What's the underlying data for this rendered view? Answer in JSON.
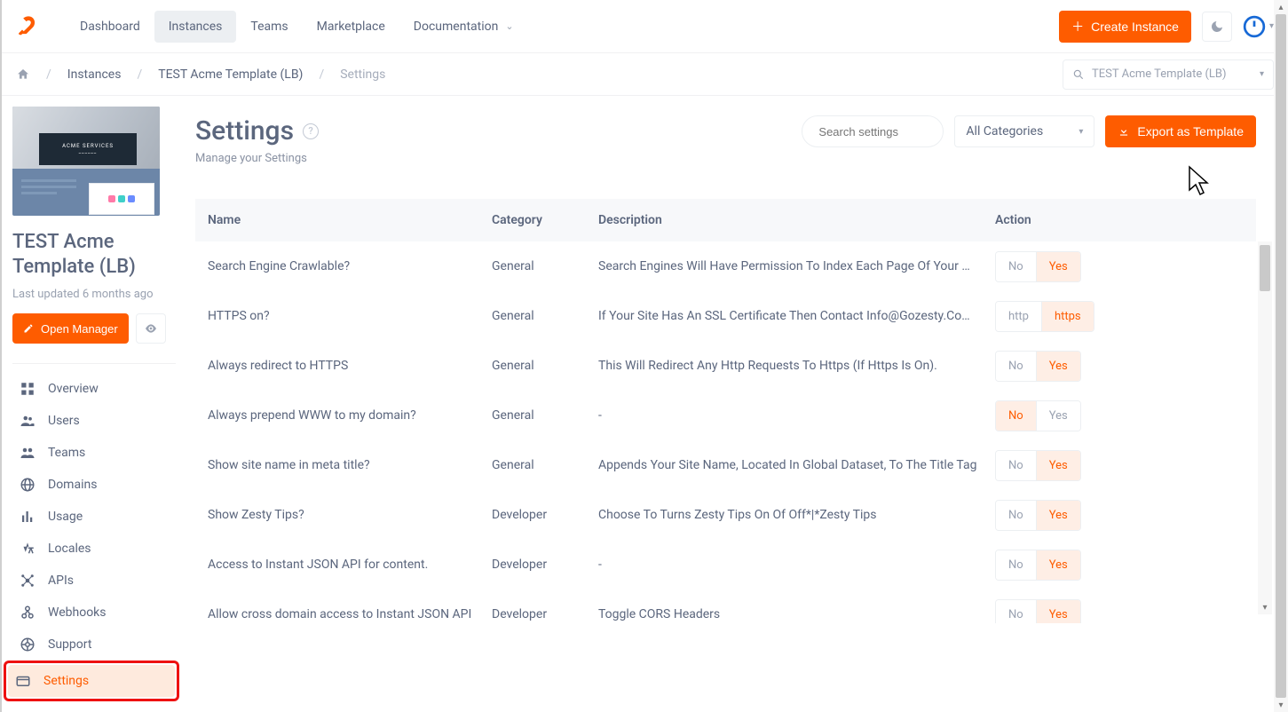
{
  "nav": {
    "items": [
      "Dashboard",
      "Instances",
      "Teams",
      "Marketplace"
    ],
    "active_index": 1,
    "documentation": "Documentation",
    "create_button": "Create Instance"
  },
  "breadcrumb": {
    "items": [
      "Instances",
      "TEST Acme Template (LB)",
      "Settings"
    ],
    "search_value": "TEST Acme Template (LB)"
  },
  "sidebar": {
    "instance_name": "TEST Acme Template (LB)",
    "updated": "Last updated 6 months ago",
    "open_manager": "Open Manager",
    "thumb_title": "ACME SERVICES",
    "items": [
      {
        "icon": "dashboard",
        "label": "Overview"
      },
      {
        "icon": "users",
        "label": "Users"
      },
      {
        "icon": "teams",
        "label": "Teams"
      },
      {
        "icon": "globe",
        "label": "Domains"
      },
      {
        "icon": "bars",
        "label": "Usage"
      },
      {
        "icon": "locale",
        "label": "Locales"
      },
      {
        "icon": "api",
        "label": "APIs"
      },
      {
        "icon": "webhook",
        "label": "Webhooks"
      },
      {
        "icon": "support",
        "label": "Support"
      },
      {
        "icon": "settings",
        "label": "Settings"
      }
    ],
    "active_index": 9
  },
  "page": {
    "title": "Settings",
    "subtitle": "Manage your Settings",
    "search_placeholder": "Search settings",
    "category_select": "All Categories",
    "export_button": "Export as Template"
  },
  "table": {
    "headers": {
      "name": "Name",
      "category": "Category",
      "description": "Description",
      "action": "Action"
    },
    "rows": [
      {
        "name": "Search Engine Crawlable?",
        "category": "General",
        "description": "Search Engines Will Have Permission To Index Each Page Of Your Site Allowing F...",
        "options": [
          "No",
          "Yes"
        ],
        "selected": 1
      },
      {
        "name": "HTTPS on?",
        "category": "General",
        "description": "If Your Site Has An SSL Certificate Then Contact Info@Gozesty.Com About Secur...",
        "options": [
          "http",
          "https"
        ],
        "selected": 1
      },
      {
        "name": "Always redirect to HTTPS",
        "category": "General",
        "description": "This Will Redirect Any Http Requests To Https (If Https Is On).",
        "options": [
          "No",
          "Yes"
        ],
        "selected": 1
      },
      {
        "name": "Always prepend WWW to my domain?",
        "category": "General",
        "description": "-",
        "options": [
          "No",
          "Yes"
        ],
        "selected": 0
      },
      {
        "name": "Show site name in meta title?",
        "category": "General",
        "description": "Appends Your Site Name, Located In Global Dataset, To The Title Tag",
        "options": [
          "No",
          "Yes"
        ],
        "selected": 1
      },
      {
        "name": "Show Zesty Tips?",
        "category": "Developer",
        "description": "Choose To Turns Zesty Tips On Of Off*|*Zesty Tips",
        "options": [
          "No",
          "Yes"
        ],
        "selected": 1
      },
      {
        "name": "Access to Instant JSON API for content.",
        "category": "Developer",
        "description": "-",
        "options": [
          "No",
          "Yes"
        ],
        "selected": 1
      },
      {
        "name": "Allow cross domain access to Instant JSON API",
        "category": "Developer",
        "description": "Toggle CORS Headers",
        "options": [
          "No",
          "Yes"
        ],
        "selected": 1
      }
    ]
  },
  "colors": {
    "accent": "#fe5c00",
    "highlight_border": "#e11"
  }
}
